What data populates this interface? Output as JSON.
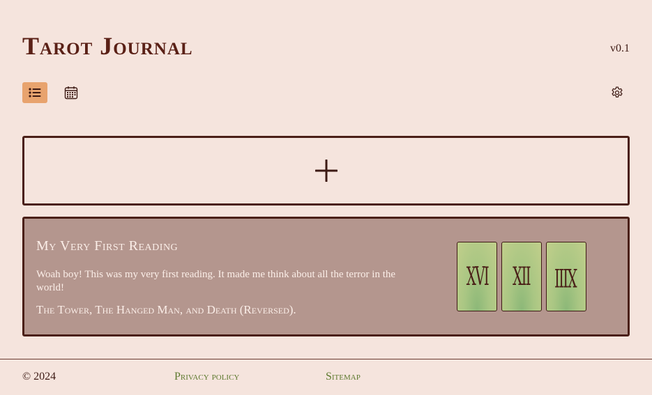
{
  "app": {
    "title": "Tarot Journal",
    "version": "v0.1"
  },
  "toolbar": {
    "list_view": {
      "icon": "list-icon",
      "active": true
    },
    "calendar_view": {
      "icon": "calendar-icon",
      "active": false
    },
    "settings": {
      "icon": "gear-icon"
    }
  },
  "add_reading": {
    "icon": "plus-icon"
  },
  "readings": [
    {
      "title": "My Very First Reading",
      "body": "Woah boy! This was my very first reading. It made me think about all the terror in the world!",
      "cards_text": "The Tower, The Hanged Man, and Death (Reversed).",
      "cards": [
        {
          "numeral": "XVI",
          "reversed": false
        },
        {
          "numeral": "XII",
          "reversed": false
        },
        {
          "numeral": "XIII",
          "reversed": true
        }
      ]
    }
  ],
  "footer": {
    "copyright": "© 2024",
    "privacy": "Privacy policy",
    "sitemap": "Sitemap"
  },
  "colors": {
    "background": "#f5e4dd",
    "accent": "#e8a36e",
    "card_bg": "#b4968e",
    "link": "#5e7a2f",
    "border": "#4a1f17"
  }
}
